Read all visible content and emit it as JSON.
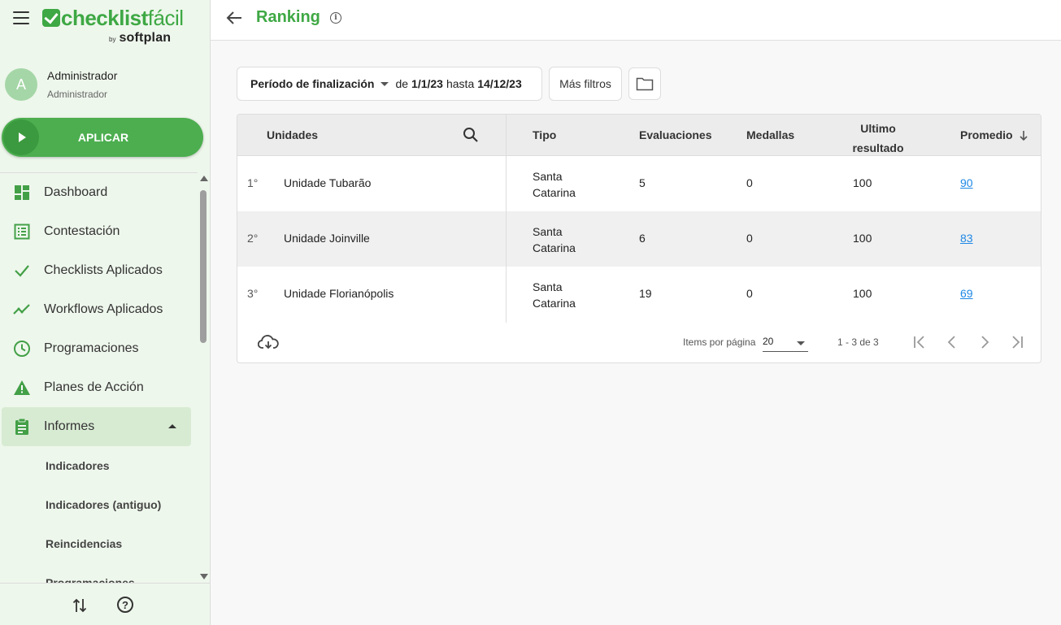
{
  "sidebar": {
    "logo": {
      "brand_bold": "checklist",
      "brand_thin": "fácil",
      "by": "by",
      "company": "softplan"
    },
    "user": {
      "initial": "A",
      "name": "Administrador",
      "role": "Administrador"
    },
    "apply_label": "APLICAR",
    "nav": [
      {
        "label": "Dashboard",
        "icon": "dashboard-icon"
      },
      {
        "label": "Contestación",
        "icon": "list-icon"
      },
      {
        "label": "Checklists Aplicados",
        "icon": "check-icon"
      },
      {
        "label": "Workflows Aplicados",
        "icon": "trend-icon"
      },
      {
        "label": "Programaciones",
        "icon": "clock-icon"
      },
      {
        "label": "Planes de Acción",
        "icon": "warning-icon"
      },
      {
        "label": "Informes",
        "icon": "clipboard-icon"
      }
    ],
    "sub_items": [
      "Indicadores",
      "Indicadores (antiguo)",
      "Reincidencias",
      "Programaciones"
    ],
    "help_glyph": "?"
  },
  "header": {
    "title": "Ranking",
    "info_glyph": "i"
  },
  "filters": {
    "period_label": "Período de finalización",
    "from_word": "de",
    "from_date": "1/1/23",
    "to_word": "hasta",
    "to_date": "14/12/23",
    "more_filters": "Más filtros"
  },
  "table": {
    "headers": {
      "unidades": "Unidades",
      "tipo": "Tipo",
      "evaluaciones": "Evaluaciones",
      "medallas": "Medallas",
      "ultimo_1": "Ultimo",
      "ultimo_2": "resultado",
      "promedio": "Promedio"
    },
    "rows": [
      {
        "rank": "1°",
        "unit": "Unidade Tubarão",
        "tipo_1": "Santa",
        "tipo_2": "Catarina",
        "evaluaciones": "5",
        "medallas": "0",
        "ultimo": "100",
        "promedio": "90"
      },
      {
        "rank": "2°",
        "unit": "Unidade Joinville",
        "tipo_1": "Santa",
        "tipo_2": "Catarina",
        "evaluaciones": "6",
        "medallas": "0",
        "ultimo": "100",
        "promedio": "83"
      },
      {
        "rank": "3°",
        "unit": "Unidade Florianópolis",
        "tipo_1": "Santa",
        "tipo_2": "Catarina",
        "evaluaciones": "19",
        "medallas": "0",
        "ultimo": "100",
        "promedio": "69"
      }
    ],
    "footer": {
      "items_label": "Items por página",
      "page_size": "20",
      "range": "1 - 3 de 3"
    }
  },
  "colors": {
    "brand_green": "#3ea844",
    "apply_green": "#4cae4f",
    "link_blue": "#1e88e5",
    "sidebar_bg": "#eef7ec"
  }
}
